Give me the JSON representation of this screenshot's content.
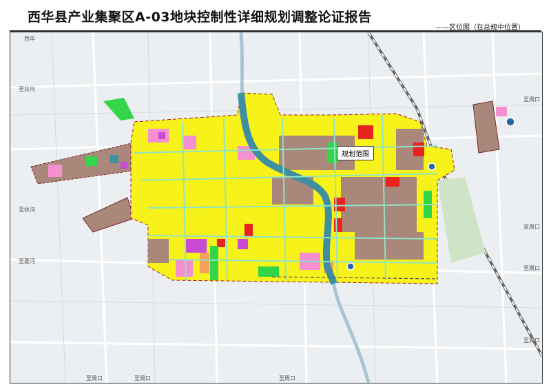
{
  "title": "西华县产业集聚区A-03地块控制性详细规划调整论证报告",
  "subtitle": "——区位图（在总规中位置）",
  "callout": "规划范围",
  "roads": {
    "west_top": "至扶沟",
    "west_mid": "至扶沟",
    "west_low": "至夏河",
    "east_top": "至周口",
    "east_mid1": "至周口",
    "east_mid2": "至周口",
    "east_bottom": "至周口",
    "bottom1": "至周口",
    "bottom2": "至周口",
    "bottom3": "至周口",
    "topleft": "西华"
  },
  "colors": {
    "residential": "#f7f21a",
    "commercial": "#e8231f",
    "industrial": "#a9877a",
    "green": "#33d649",
    "pink": "#f48fd0",
    "purple": "#c74bd3",
    "orange": "#f4a15a",
    "water": "#3d8fa1",
    "background": "#eceff1"
  },
  "icons": {
    "station_top": "train-station-icon",
    "station_bottom": "bus-station-icon",
    "station_east": "airport-icon"
  }
}
